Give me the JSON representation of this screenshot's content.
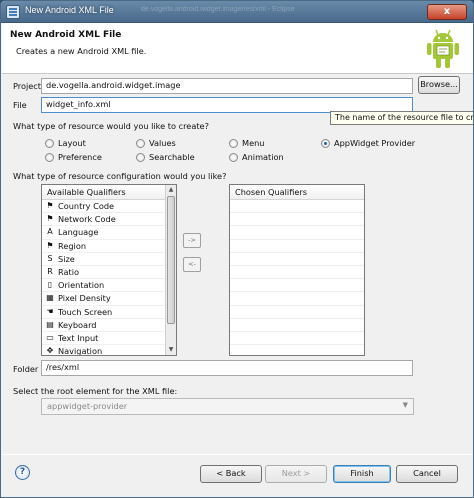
{
  "window": {
    "title": "New Android XML File",
    "background_title": "de.vogella.android.widget.image/res/xml - Eclipse",
    "close_glyph": "x"
  },
  "header": {
    "title": "New Android XML File",
    "description": "Creates a new Android XML file."
  },
  "project": {
    "label": "Project",
    "value": "de.vogella.android.widget.image",
    "browse_label": "Browse..."
  },
  "file": {
    "label": "File",
    "value": "widget_info.xml",
    "tooltip": "The name of the resource file to create"
  },
  "resource_type": {
    "question": "What type of resource would you like to create?",
    "options": [
      {
        "label": "Layout",
        "checked": false
      },
      {
        "label": "Values",
        "checked": false
      },
      {
        "label": "Menu",
        "checked": false
      },
      {
        "label": "AppWidget Provider",
        "checked": true
      },
      {
        "label": "Preference",
        "checked": false
      },
      {
        "label": "Searchable",
        "checked": false
      },
      {
        "label": "Animation",
        "checked": false
      }
    ]
  },
  "configuration": {
    "question": "What type of resource configuration would you like?",
    "available_header": "Available Qualifiers",
    "chosen_header": "Chosen Qualifiers",
    "add_label": "->",
    "remove_label": "<-",
    "qualifiers": [
      {
        "label": "Country Code",
        "icon": "flag-icon",
        "glyph": "⚑"
      },
      {
        "label": "Network Code",
        "icon": "network-icon",
        "glyph": "⚑"
      },
      {
        "label": "Language",
        "icon": "language-icon",
        "glyph": "A"
      },
      {
        "label": "Region",
        "icon": "region-icon",
        "glyph": "⚑"
      },
      {
        "label": "Size",
        "icon": "size-icon",
        "glyph": "S"
      },
      {
        "label": "Ratio",
        "icon": "ratio-icon",
        "glyph": "R"
      },
      {
        "label": "Orientation",
        "icon": "orientation-icon",
        "glyph": "▯"
      },
      {
        "label": "Pixel Density",
        "icon": "pixel-density-icon",
        "glyph": "▦"
      },
      {
        "label": "Touch Screen",
        "icon": "touch-screen-icon",
        "glyph": "☚"
      },
      {
        "label": "Keyboard",
        "icon": "keyboard-icon",
        "glyph": "▤"
      },
      {
        "label": "Text Input",
        "icon": "text-input-icon",
        "glyph": "▭"
      },
      {
        "label": "Navigation",
        "icon": "navigation-icon",
        "glyph": "✥"
      }
    ]
  },
  "folder": {
    "label": "Folder",
    "value": "/res/xml"
  },
  "root_element": {
    "label": "Select the root element for the XML file:",
    "value": "appwidget-provider",
    "caret": "▼"
  },
  "footer": {
    "help_glyph": "?",
    "back_label": "< Back",
    "next_label": "Next >",
    "finish_label": "Finish",
    "cancel_label": "Cancel"
  },
  "colors": {
    "title_bar": "#48698a",
    "android_green": "#a4c639",
    "accent": "#3c7fb1"
  }
}
